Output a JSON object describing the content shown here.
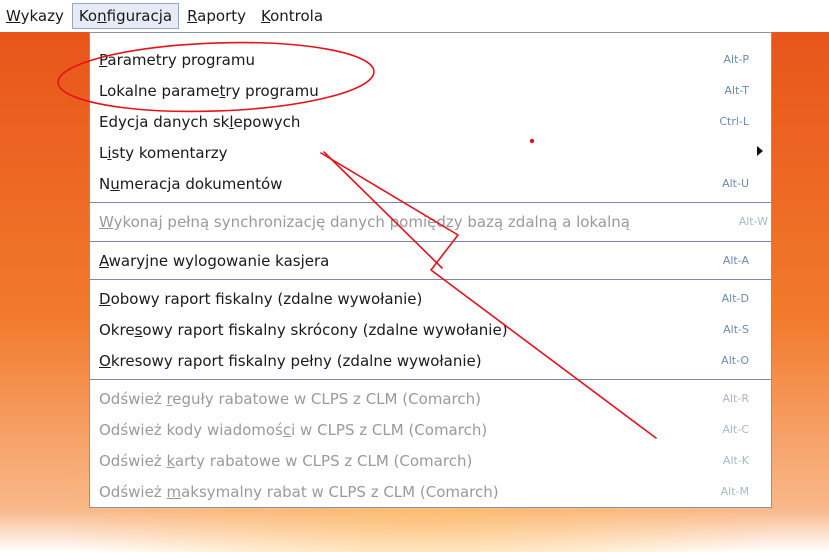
{
  "menubar": {
    "items": [
      {
        "label_pre": "",
        "label_ul": "W",
        "label_post": "ykazy"
      },
      {
        "label_pre": "Ko",
        "label_ul": "n",
        "label_post": "figuracja"
      },
      {
        "label_pre": "",
        "label_ul": "R",
        "label_post": "aporty"
      },
      {
        "label_pre": "",
        "label_ul": "K",
        "label_post": "ontrola"
      }
    ]
  },
  "dropdown": {
    "items": [
      {
        "label_pre": "",
        "label_ul": "P",
        "label_post": "arametry programu",
        "shortcut": "Alt-P",
        "disabled": false
      },
      {
        "label_pre": "Lokalne parame",
        "label_ul": "t",
        "label_post": "ry programu",
        "shortcut": "Alt-T",
        "disabled": false
      },
      {
        "label_pre": "Edycja danych sk",
        "label_ul": "l",
        "label_post": "epowych",
        "shortcut": "Ctrl-L",
        "disabled": false
      },
      {
        "label_pre": "L",
        "label_ul": "i",
        "label_post": "sty komentarzy",
        "shortcut": "",
        "disabled": false,
        "submenu": true
      },
      {
        "label_pre": "N",
        "label_ul": "u",
        "label_post": "meracja dokumentów",
        "shortcut": "Alt-U",
        "disabled": false
      },
      {
        "label_pre": "",
        "label_ul": "W",
        "label_post": "ykonaj pełną synchronizację danych pomiędzy bazą zdalną a lokalną",
        "shortcut": "Alt-W",
        "disabled": true
      },
      {
        "label_pre": "",
        "label_ul": "A",
        "label_post": "waryjne wylogowanie kasjera",
        "shortcut": "Alt-A",
        "disabled": false
      },
      {
        "label_pre": "",
        "label_ul": "D",
        "label_post": "obowy raport fiskalny (zdalne wywołanie)",
        "shortcut": "Alt-D",
        "disabled": false
      },
      {
        "label_pre": "Okre",
        "label_ul": "s",
        "label_post": "owy raport fiskalny skrócony (zdalne wywołanie)",
        "shortcut": "Alt-S",
        "disabled": false
      },
      {
        "label_pre": "",
        "label_ul": "O",
        "label_post": "kresowy raport fiskalny pełny (zdalne wywołanie)",
        "shortcut": "Alt-O",
        "disabled": false
      },
      {
        "label_pre": "Odśwież ",
        "label_ul": "r",
        "label_post": "eguły rabatowe w CLPS z CLM (Comarch)",
        "shortcut": "Alt-R",
        "disabled": true
      },
      {
        "label_pre": "Odśwież kody wiadomoś",
        "label_ul": "c",
        "label_post": "i w CLPS z CLM (Comarch)",
        "shortcut": "Alt-C",
        "disabled": true
      },
      {
        "label_pre": "Odśwież ",
        "label_ul": "k",
        "label_post": "arty rabatowe w CLPS z CLM (Comarch)",
        "shortcut": "Alt-K",
        "disabled": true
      },
      {
        "label_pre": "Odśwież ",
        "label_ul": "m",
        "label_post": "aksymalny rabat w CLPS z CLM (Comarch)",
        "shortcut": "Alt-M",
        "disabled": true
      }
    ]
  },
  "annotation": {
    "color": "#e8101a"
  }
}
